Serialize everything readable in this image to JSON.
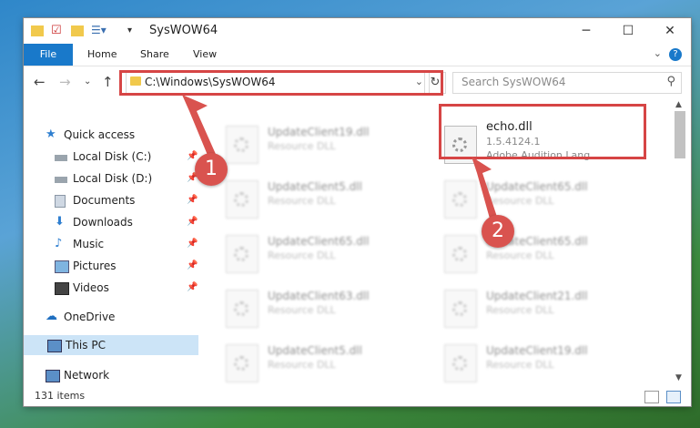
{
  "window": {
    "title": "SysWOW64"
  },
  "ribbon": {
    "file": "File",
    "tabs": [
      "Home",
      "Share",
      "View"
    ],
    "help": "?"
  },
  "address": {
    "path": "C:\\Windows\\SysWOW64"
  },
  "search": {
    "placeholder": "Search SysWOW64"
  },
  "nav": {
    "quick_access": "Quick access",
    "items": [
      "Local Disk (C:)",
      "Local Disk (D:)",
      "Documents",
      "Downloads",
      "Music",
      "Pictures",
      "Videos"
    ],
    "onedrive": "OneDrive",
    "thispc": "This PC",
    "network": "Network"
  },
  "highlighted": {
    "name": "echo.dll",
    "version": "1.5.4124.1",
    "desc": "Adobe Audition Lang..."
  },
  "files": [
    {
      "name": "UpdateClient19.dll",
      "desc": "Resource DLL"
    },
    {
      "name": "UpdateClient5.dll",
      "desc": "Resource DLL"
    },
    {
      "name": "UpdateClient65.dll",
      "desc": "Resource DLL"
    },
    {
      "name": "UpdateClient65.dll",
      "desc": "Resource DLL"
    },
    {
      "name": "UpdateClient65.dll",
      "desc": "Resource DLL"
    },
    {
      "name": "UpdateClient63.dll",
      "desc": "Resource DLL"
    },
    {
      "name": "UpdateClient21.dll",
      "desc": "Resource DLL"
    },
    {
      "name": "UpdateClient5.dll",
      "desc": "Resource DLL"
    },
    {
      "name": "UpdateClient19.dll",
      "desc": "Resource DLL"
    }
  ],
  "status": {
    "items": "131 items"
  },
  "annotations": {
    "step1": "1",
    "step2": "2"
  }
}
